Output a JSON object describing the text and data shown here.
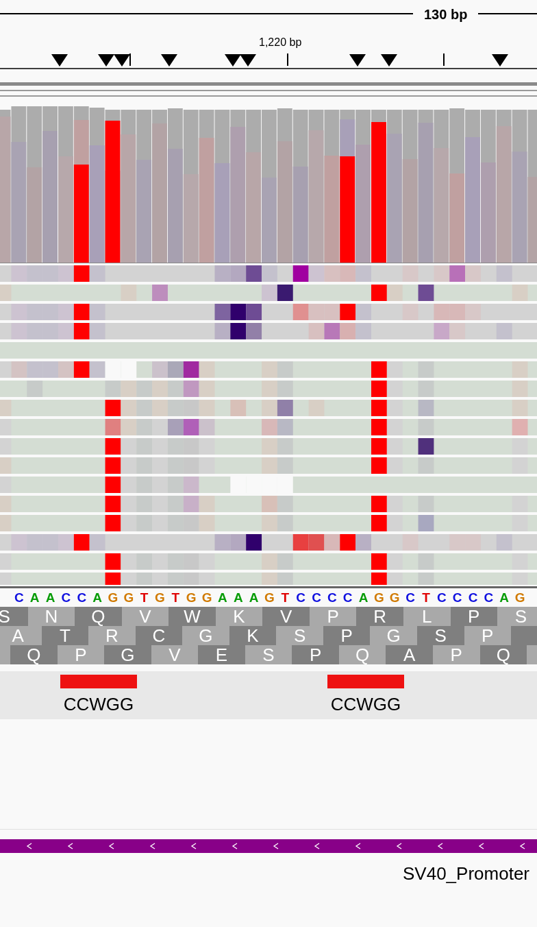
{
  "ruler": {
    "span": "130 bp",
    "position_label": "1,220 bp"
  },
  "sequence": {
    "bases": [
      "C",
      "A",
      "A",
      "C",
      "C",
      "A",
      "G",
      "G",
      "T",
      "G",
      "T",
      "G",
      "G",
      "A",
      "A",
      "A",
      "G",
      "T",
      "C",
      "C",
      "C",
      "C",
      "A",
      "G",
      "G",
      "C",
      "T",
      "C",
      "C",
      "C",
      "C",
      "A",
      "G"
    ]
  },
  "translation": {
    "frames": [
      {
        "residues": [
          "S",
          "N",
          "Q",
          "V",
          "W",
          "K",
          "V",
          "P",
          "R",
          "L",
          "P",
          "S"
        ]
      },
      {
        "residues": [
          "A",
          "T",
          "R",
          "C",
          "G",
          "K",
          "S",
          "P",
          "G",
          "S",
          "P"
        ]
      },
      {
        "residues": [
          "Q",
          "P",
          "G",
          "V",
          "E",
          "S",
          "P",
          "Q",
          "A",
          "P",
          "Q"
        ]
      }
    ]
  },
  "features": [
    {
      "label": "CCWGG"
    },
    {
      "label": "CCWGG"
    }
  ],
  "gene_track": {
    "label": "SV40_Promoter"
  }
}
